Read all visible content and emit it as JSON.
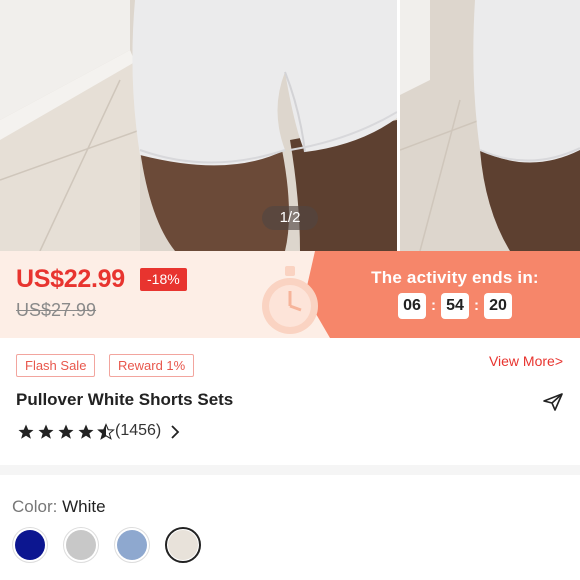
{
  "gallery": {
    "pager": "1/2"
  },
  "price": {
    "current": "US$22.99",
    "discount": "-18%",
    "original": "US$27.99"
  },
  "activity": {
    "label": "The activity ends in:",
    "hours": "06",
    "minutes": "54",
    "seconds": "20",
    "separator": ":"
  },
  "tags": {
    "flash_sale": "Flash Sale",
    "reward": "Reward 1%",
    "view_more": "View More>"
  },
  "product": {
    "title": "Pullover White Shorts Sets",
    "rating": 4.5,
    "reviews": "(1456)"
  },
  "color": {
    "label": "Color:",
    "value": "White",
    "swatches": [
      {
        "name": "navy",
        "hex": "#0c1690"
      },
      {
        "name": "grey",
        "hex": "#c8c8c8"
      },
      {
        "name": "light-blue",
        "hex": "#8ea8cf"
      },
      {
        "name": "white",
        "hex": "#e8e2da",
        "selected": true
      }
    ]
  },
  "colors": {
    "accent": "#e8342f",
    "timer_band": "#f6866a",
    "price_band": "#fdeee6"
  },
  "icons": {
    "share": "send-icon",
    "chevron": "chevron-right-icon",
    "stopwatch": "stopwatch-icon"
  }
}
